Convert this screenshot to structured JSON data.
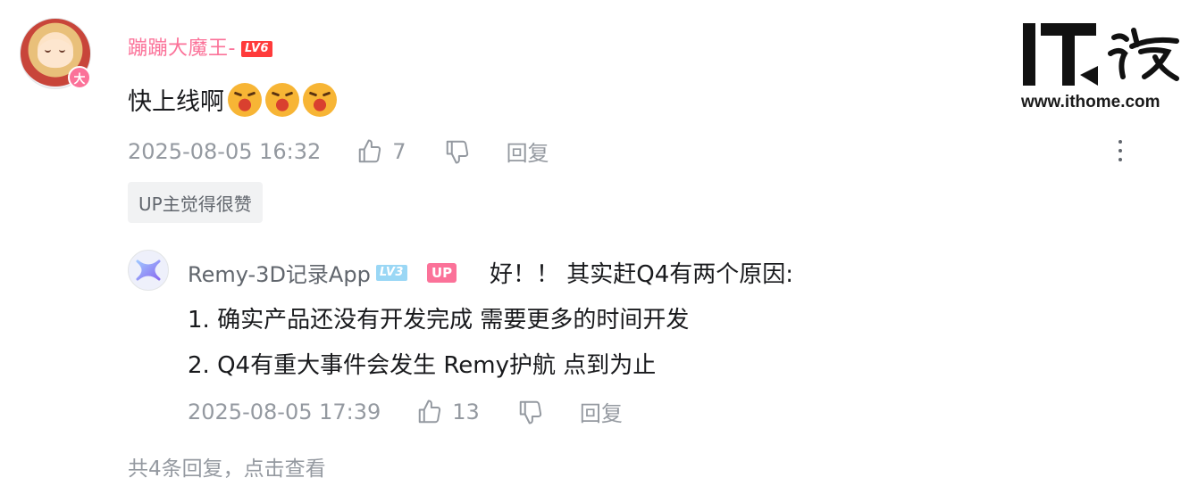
{
  "comment": {
    "username": "蹦蹦大魔王-",
    "level_badge": "LV6",
    "avatar_badge": "大",
    "text": "快上线啊",
    "emoji_count": 3,
    "timestamp": "2025-08-05 16:32",
    "like_count": "7",
    "reply_label": "回复",
    "up_liked_tag": "UP主觉得很赞"
  },
  "reply": {
    "username": "Remy-3D记录App",
    "level_badge": "LV3",
    "up_badge": "UP",
    "line1": "好！！ 其实赶Q4有两个原因:",
    "line2": "1. 确实产品还没有开发完成 需要更多的时间开发",
    "line3": "2. Q4有重大事件会发生 Remy护航 点到为止",
    "timestamp": "2025-08-05 17:39",
    "like_count": "13",
    "reply_label": "回复"
  },
  "view_more": "共4条回复，点击查看",
  "watermark": {
    "logo_text": "IT之家",
    "url": "www.ithome.com"
  },
  "colors": {
    "username_pink": "#fb7299",
    "meta_gray": "#9499a0",
    "text_dark": "#18191c",
    "level6_red": "#ff3b3b",
    "level3_blue": "#9ad7f5"
  },
  "icons": [
    "like-icon",
    "dislike-icon",
    "more-icon",
    "emoji-shouting"
  ]
}
